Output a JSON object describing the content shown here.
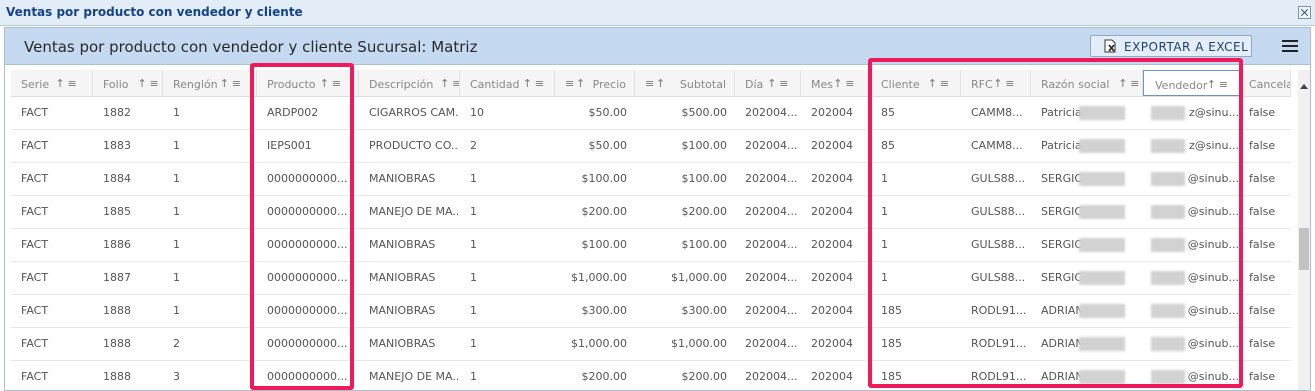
{
  "window": {
    "title": "Ventas por producto con vendedor y cliente"
  },
  "toolbar": {
    "heading": "Ventas por producto con vendedor y cliente Sucursal: Matriz",
    "export_label": "EXPORTAR A EXCEL"
  },
  "icons": {
    "close": "close-icon",
    "excel": "excel-export-icon",
    "menu": "hamburger-menu-icon",
    "sort": "sort-arrow-icon",
    "filter": "filter-icon"
  },
  "colors": {
    "highlight": "#f0195a",
    "toolbar": "#c5d9f1",
    "title": "#15428b"
  },
  "columns": [
    {
      "label": "Serie"
    },
    {
      "label": "Folio"
    },
    {
      "label": "Renglón"
    },
    {
      "label": "Producto"
    },
    {
      "label": "Descripción"
    },
    {
      "label": "Cantidad"
    },
    {
      "label": "Precio"
    },
    {
      "label": "Subtotal"
    },
    {
      "label": "Día"
    },
    {
      "label": "Mes"
    },
    {
      "label": "Cliente"
    },
    {
      "label": "RFC"
    },
    {
      "label": "Razón social"
    },
    {
      "label": "Vendedor"
    },
    {
      "label": "Cancelada"
    }
  ],
  "rows": [
    [
      "FACT",
      "1882",
      "1",
      "ARDP002",
      "CIGARROS CAM...",
      "10",
      "$50.00",
      "$500.00",
      "202004...",
      "202004",
      "85",
      "CAMM8...",
      "Patricia",
      "z@sinu...",
      "false"
    ],
    [
      "FACT",
      "1883",
      "1",
      "IEPS001",
      "PRODUCTO CO...",
      "2",
      "$50.00",
      "$100.00",
      "202004...",
      "202004",
      "85",
      "CAMM8...",
      "Patricia",
      "z@sinu...",
      "false"
    ],
    [
      "FACT",
      "1884",
      "1",
      "0000000000...",
      "MANIOBRAS",
      "1",
      "$100.00",
      "$100.00",
      "202004...",
      "202004",
      "1",
      "GULS88...",
      "SERGIO",
      "@sinub...",
      "false"
    ],
    [
      "FACT",
      "1885",
      "1",
      "0000000000...",
      "MANEJO DE MA...",
      "1",
      "$200.00",
      "$200.00",
      "202004...",
      "202004",
      "1",
      "GULS88...",
      "SERGIO",
      "@sinub...",
      "false"
    ],
    [
      "FACT",
      "1886",
      "1",
      "0000000000...",
      "MANIOBRAS",
      "1",
      "$100.00",
      "$100.00",
      "202004...",
      "202004",
      "1",
      "GULS88...",
      "SERGIO",
      "@sinub...",
      "false"
    ],
    [
      "FACT",
      "1887",
      "1",
      "0000000000...",
      "MANIOBRAS",
      "1",
      "$1,000.00",
      "$1,000.00",
      "202004...",
      "202004",
      "1",
      "GULS88...",
      "SERGIO",
      "@sinub...",
      "false"
    ],
    [
      "FACT",
      "1888",
      "1",
      "0000000000...",
      "MANIOBRAS",
      "1",
      "$300.00",
      "$300.00",
      "202004...",
      "202004",
      "185",
      "RODL91...",
      "ADRIAN",
      "@sinub...",
      "false"
    ],
    [
      "FACT",
      "1888",
      "2",
      "0000000000...",
      "MANIOBRAS",
      "1",
      "$1,000.00",
      "$1,000.00",
      "202004...",
      "202004",
      "185",
      "RODL91...",
      "ADRIAN",
      "@sinub...",
      "false"
    ],
    [
      "FACT",
      "1888",
      "3",
      "0000000000...",
      "MANEJO DE MA...",
      "1",
      "$200.00",
      "$200.00",
      "202004...",
      "202004",
      "185",
      "RODL91...",
      "ADRIAN",
      "@sinub...",
      "false"
    ]
  ]
}
